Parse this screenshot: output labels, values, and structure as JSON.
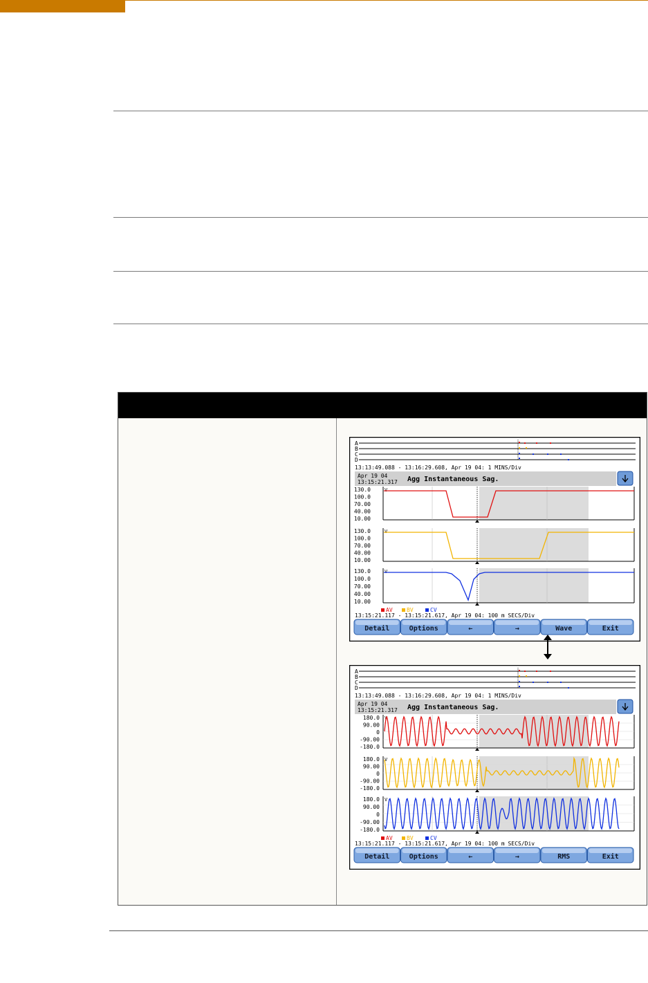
{
  "screens": [
    {
      "id": "rms",
      "ch_labels": [
        "A",
        "B",
        "C",
        "D"
      ],
      "time_range": "13:13:49.088 - 13:16:29.608, Apr 19 04:   1 MINS/Div",
      "event_date": "Apr 19 04",
      "event_time": "13:15:21.317",
      "event_title": "Agg Instantaneous Sag.",
      "unit": "V",
      "y_ticks": [
        "130.0",
        "100.0",
        "70.00",
        "40.00",
        "10.00"
      ],
      "legend": [
        "AV",
        "BV",
        "CV"
      ],
      "bottom_range": "13:15:21.117 - 13:15:21.617, Apr 19 04:   100 m SECS/Div",
      "buttons": [
        "Detail",
        "Options",
        "←",
        "→",
        "Wave",
        "Exit"
      ],
      "scroll_icon": "down-arrow-icon"
    },
    {
      "id": "wave",
      "ch_labels": [
        "A",
        "B",
        "C",
        "D"
      ],
      "time_range": "13:13:49.088 - 13:16:29.608, Apr 19 04:   1 MINS/Div",
      "event_date": "Apr 19 04",
      "event_time": "13:15:21.317",
      "event_title": "Agg Instantaneous Sag.",
      "unit": "V",
      "y_ticks": [
        "180.0",
        "90.00",
        "0",
        "-90.00",
        "-180.0"
      ],
      "legend": [
        "AV",
        "BV",
        "CV"
      ],
      "bottom_range": "13:15:21.117 - 13:15:21.617, Apr 19 04:   100 m SECS/Div",
      "buttons": [
        "Detail",
        "Options",
        "←",
        "→",
        "RMS",
        "Exit"
      ],
      "scroll_icon": "down-arrow-icon"
    }
  ],
  "colors": {
    "a": "#e01010",
    "b": "#f2b400",
    "c": "#1030e0",
    "accent": "#c97a00"
  }
}
